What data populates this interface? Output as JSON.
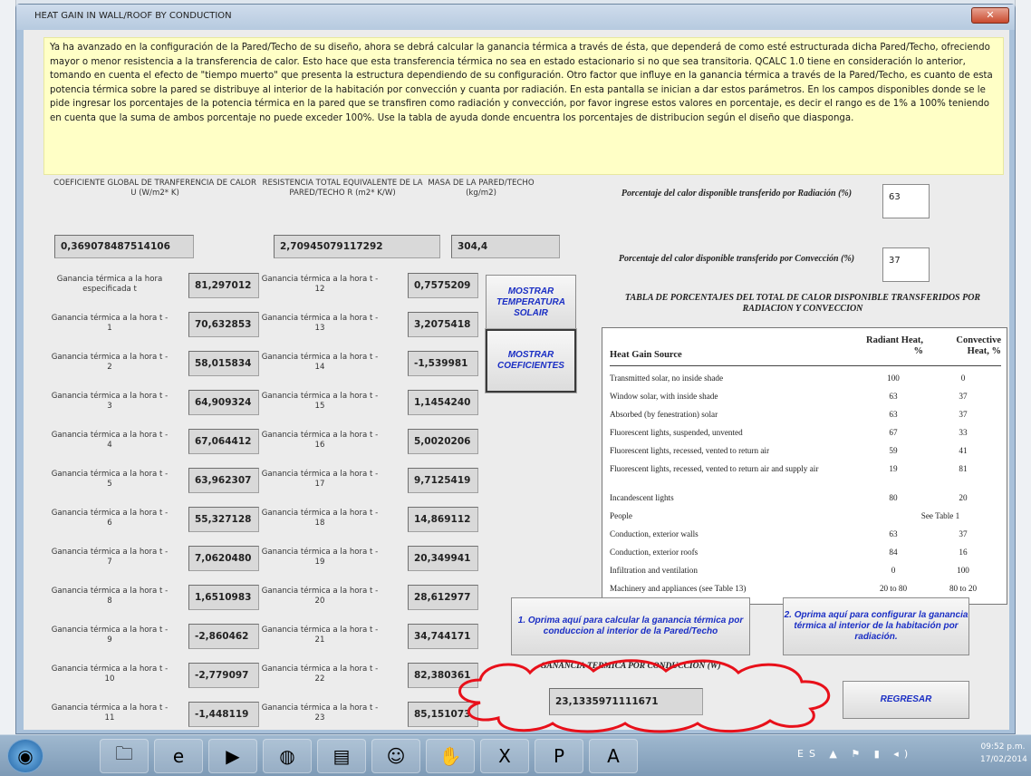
{
  "window": {
    "title": "HEAT GAIN IN WALL/ROOF BY CONDUCTION",
    "close_label": "✕"
  },
  "intro_text": "Ya ha avanzado en la configuración de la Pared/Techo de su diseño, ahora se debrá calcular la ganancia térmica a través de ésta, que dependerá de como esté estructurada dicha Pared/Techo, ofreciendo mayor o menor resistencia a la transferencia de calor. Esto hace que esta transferencia térmica no sea en estado estacionario si no que sea transitoria. QCALC 1.0 tiene en consideración lo anterior, tomando en cuenta el efecto de \"tiempo muerto\" que presenta la estructura dependiendo de su configuración. Otro factor que influye en la ganancia térmica a través de la Pared/Techo, es cuanto de esta potencia térmica sobre la pared se distribuye al interior de la habitación por convección y cuanta por radiación. En esta pantalla se inician a dar estos parámetros. En los campos disponibles donde se le pide ingresar los porcentajes de la potencia térmica en la pared que se transfiren como radiación y convección, por favor ingrese estos valores en porcentaje, es decir el rango es de 1% a 100% teniendo en cuenta que la suma de ambos porcentaje no puede exceder 100%. Use la tabla de ayuda donde encuentra los porcentajes de distribucion según el diseño que diasponga.",
  "coef": {
    "u_label": "COEFICIENTE GLOBAL DE TRANFERENCIA DE CALOR U (W/m2* K)",
    "u_value": "0,369078487514106",
    "r_label": "RESISTENCIA TOTAL EQUIVALENTE DE LA PARED/TECHO R (m2* K/W)",
    "r_value": "2,70945079117292",
    "m_label": "MASA DE LA PARED/TECHO (kg/m2)",
    "m_value": "304,4"
  },
  "gains_left": [
    {
      "label": "Ganancia térmica a la hora especificada t",
      "value": "81,297012"
    },
    {
      "label": "Ganancia térmica a la hora t - 1",
      "value": "70,632853"
    },
    {
      "label": "Ganancia térmica a la hora t - 2",
      "value": "58,015834"
    },
    {
      "label": "Ganancia térmica a la hora t - 3",
      "value": "64,909324"
    },
    {
      "label": "Ganancia térmica a la hora t - 4",
      "value": "67,064412"
    },
    {
      "label": "Ganancia térmica a la hora t - 5",
      "value": "63,962307"
    },
    {
      "label": "Ganancia térmica a la hora t - 6",
      "value": "55,327128"
    },
    {
      "label": "Ganancia térmica a la hora t - 7",
      "value": "7,0620480"
    },
    {
      "label": "Ganancia térmica a la hora t - 8",
      "value": "1,6510983"
    },
    {
      "label": "Ganancia térmica a la hora t - 9",
      "value": "-2,860462"
    },
    {
      "label": "Ganancia térmica a la hora t - 10",
      "value": "-2,779097"
    },
    {
      "label": "Ganancia térmica a la hora t - 11",
      "value": "-1,448119"
    }
  ],
  "gains_right": [
    {
      "label": "Ganancia térmica a la hora t - 12",
      "value": "0,7575209"
    },
    {
      "label": "Ganancia térmica a la hora t - 13",
      "value": "3,2075418"
    },
    {
      "label": "Ganancia térmica a la hora t - 14",
      "value": "-1,539981"
    },
    {
      "label": "Ganancia térmica a la hora t - 15",
      "value": "1,1454240"
    },
    {
      "label": "Ganancia térmica a la hora t - 16",
      "value": "5,0020206"
    },
    {
      "label": "Ganancia térmica a la hora t - 17",
      "value": "9,7125419"
    },
    {
      "label": "Ganancia térmica a la hora t - 18",
      "value": "14,869112"
    },
    {
      "label": "Ganancia térmica a la hora t - 19",
      "value": "20,349941"
    },
    {
      "label": "Ganancia térmica a la hora t - 20",
      "value": "28,612977"
    },
    {
      "label": "Ganancia térmica a la hora t - 21",
      "value": "34,744171"
    },
    {
      "label": "Ganancia térmica a la hora t - 22",
      "value": "82,380361"
    },
    {
      "label": "Ganancia térmica a la hora t - 23",
      "value": "85,151073"
    }
  ],
  "buttons": {
    "temp_solair": "MOSTRAR TEMPERATURA SOLAIR",
    "coeficientes": "MOSTRAR COEFICIENTES",
    "calc_conduccion": "1. Oprima aquí para calcular la ganancia térmica por conduccion al interior de la Pared/Techo",
    "config_radiacion": "2. Oprima aquí para configurar la ganancia térmica al interior de la habitación por radiación.",
    "regresar": "REGRESAR"
  },
  "percent": {
    "rad_label": "Porcentaje del calor disponible transferido por Radiación (%)",
    "rad_value": "63",
    "conv_label": "Porcentaje del calor disponible transferido por Convección (%)",
    "conv_value": "37"
  },
  "table": {
    "title": "TABLA DE PORCENTAJES DEL TOTAL DE CALOR DISPONIBLE TRANSFERIDOS POR RADIACION Y CONVECCION",
    "col_source": "Heat Gain Source",
    "col_radiant": "Radiant Heat, %",
    "col_convective": "Convective Heat, %",
    "rows": [
      {
        "source": "Transmitted solar, no inside shade",
        "radiant": "100",
        "convective": "0"
      },
      {
        "source": "Window solar, with inside shade",
        "radiant": "63",
        "convective": "37"
      },
      {
        "source": "Absorbed (by fenestration) solar",
        "radiant": "63",
        "convective": "37"
      },
      {
        "source": "Fluorescent lights, suspended, unvented",
        "radiant": "67",
        "convective": "33"
      },
      {
        "source": "Fluorescent lights, recessed, vented to return air",
        "radiant": "59",
        "convective": "41"
      },
      {
        "source": "Fluorescent lights, recessed, vented to return air and supply air",
        "radiant": "19",
        "convective": "81"
      },
      {
        "source": "Incandescent lights",
        "radiant": "80",
        "convective": "20"
      },
      {
        "source": "People",
        "radiant": "See Table 1",
        "convective": ""
      },
      {
        "source": "Conduction, exterior walls",
        "radiant": "63",
        "convective": "37"
      },
      {
        "source": "Conduction, exterior roofs",
        "radiant": "84",
        "convective": "16"
      },
      {
        "source": "Infiltration and ventilation",
        "radiant": "0",
        "convective": "100"
      },
      {
        "source": "Machinery and appliances (see Table 13)",
        "radiant": "20 to 80",
        "convective": "80 to 20"
      }
    ]
  },
  "result": {
    "label": "GANANCIA TERMICA POR CONDUCCION (W)",
    "value": "23,1335971111671"
  },
  "annotation_color": "#e8101a",
  "taskbar": {
    "icons": [
      "start-orb-icon",
      "folder-icon",
      "ie-icon",
      "media-icon",
      "chrome-icon",
      "notes-icon",
      "people-icon",
      "baseball-glove-icon",
      "excel-icon",
      "powerpoint-icon",
      "pdf-icon"
    ],
    "tray_lang": "ES",
    "time": "09:52 p.m.",
    "date": "17/02/2014"
  }
}
